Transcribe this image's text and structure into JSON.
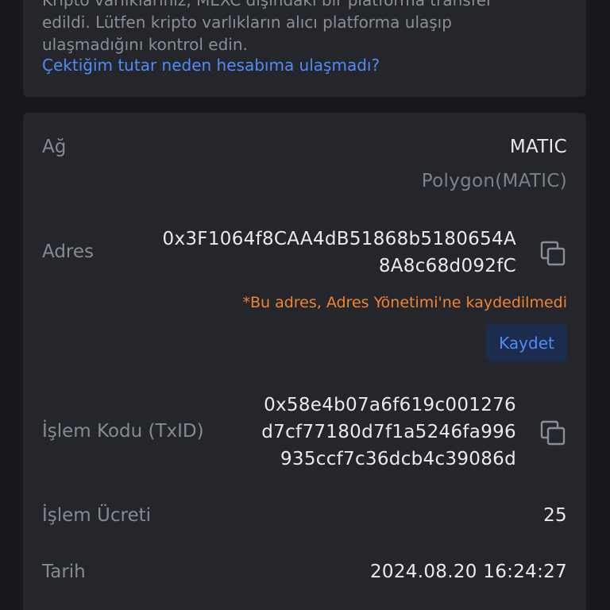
{
  "notice": {
    "line1": "Kripto varlıklarınız, MEXC dışındaki bir platforma transfer",
    "line2": "edildi. Lütfen kripto varlıkların alıcı platforma ulaşıp",
    "line3": "ulaşmadığını kontrol edin.",
    "link": "Çektiğim tutar neden hesabıma ulaşmadı?"
  },
  "details": {
    "network": {
      "label": "Ağ",
      "value": "MATIC",
      "subvalue": "Polygon(MATIC)"
    },
    "address": {
      "label": "Adres",
      "line1": "0x3F1064f8CAA4dB51868b5180654A",
      "line2": "8A8c68d092fC",
      "warning": "*Bu adres, Adres Yönetimi'ne kaydedilmedi",
      "save_label": "Kaydet"
    },
    "txid": {
      "label": "İşlem Kodu (TxID)",
      "line1": "0x58e4b07a6f619c001276",
      "line2": "d7cf77180d7f1a5246fa996",
      "line3": "935ccf7c36dcb4c39086d"
    },
    "fee": {
      "label": "İşlem Ücreti",
      "value": "25"
    },
    "date": {
      "label": "Tarih",
      "value": "2024.08.20 16:24:27"
    }
  },
  "icons": {
    "copy": "copy-icon"
  },
  "colors": {
    "background": "#16181c",
    "card": "#24262b",
    "link": "#4f8cf7",
    "warning": "#f0852d",
    "button_bg": "#1c2c4e"
  }
}
